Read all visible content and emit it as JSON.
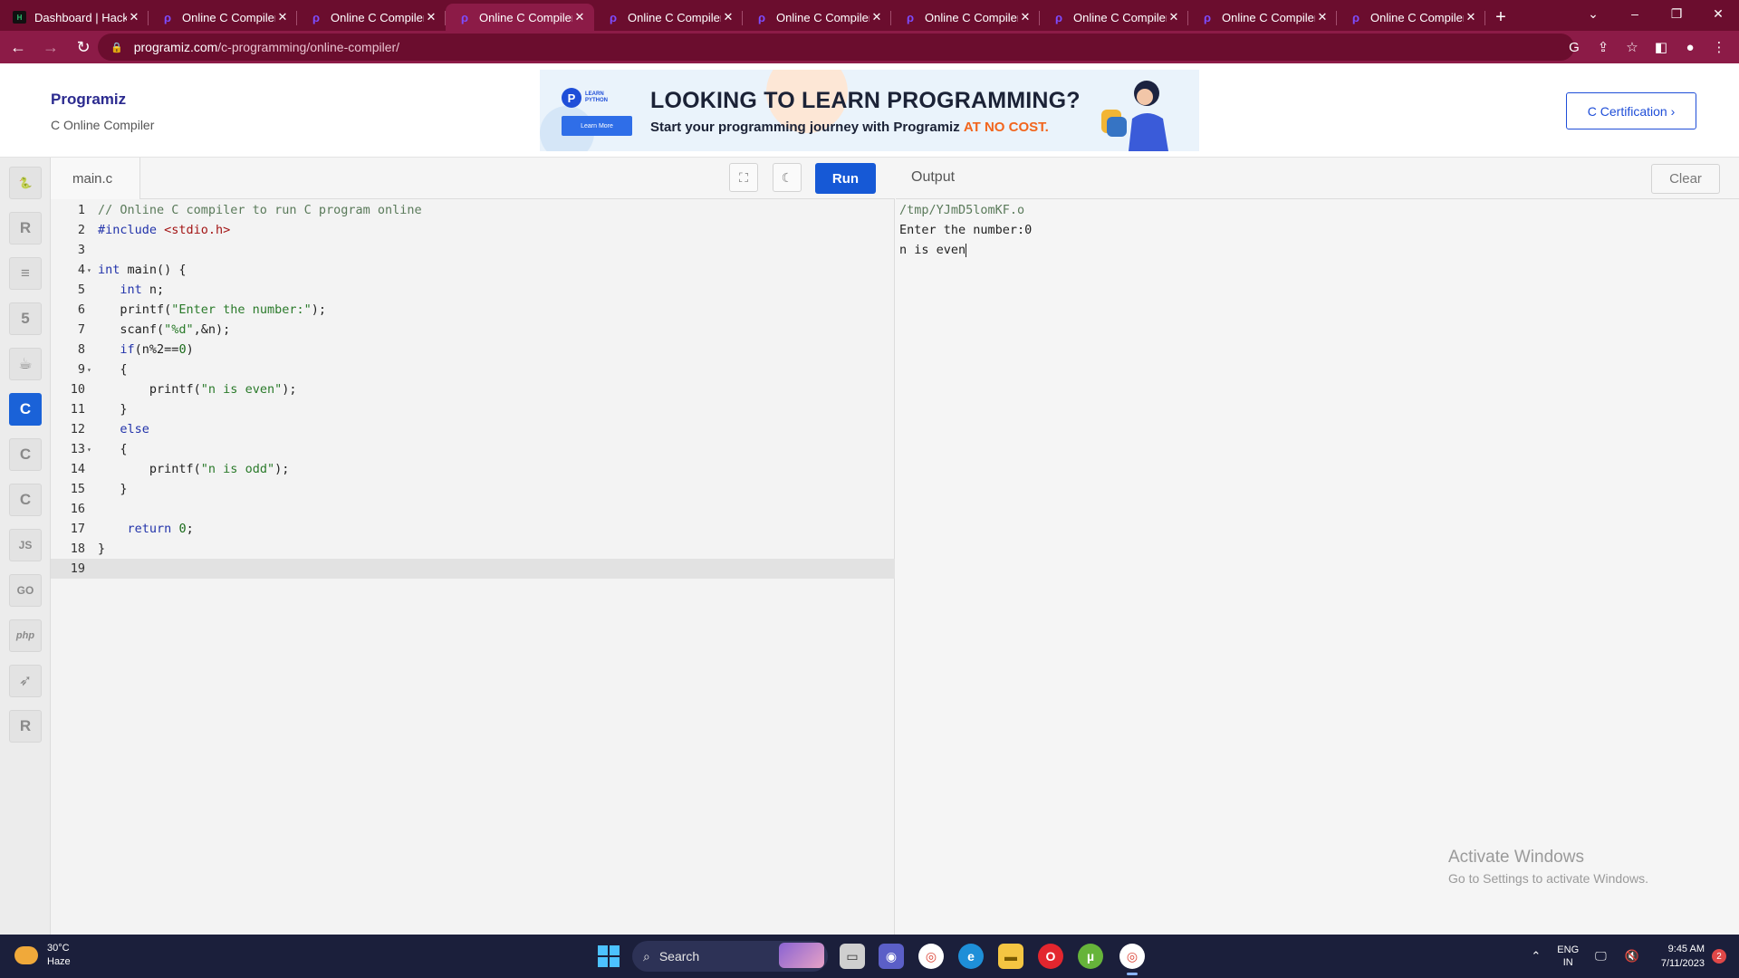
{
  "browser": {
    "tabs": [
      {
        "title": "Dashboard | Hackerr",
        "favicon": "hackerrank-icon",
        "active": false
      },
      {
        "title": "Online C Compiler",
        "favicon": "programiz-icon",
        "active": false
      },
      {
        "title": "Online C Compiler",
        "favicon": "programiz-icon",
        "active": false
      },
      {
        "title": "Online C Compiler",
        "favicon": "programiz-icon",
        "active": true
      },
      {
        "title": "Online C Compiler",
        "favicon": "programiz-icon",
        "active": false
      },
      {
        "title": "Online C Compiler",
        "favicon": "programiz-icon",
        "active": false
      },
      {
        "title": "Online C Compiler",
        "favicon": "programiz-icon",
        "active": false
      },
      {
        "title": "Online C Compiler",
        "favicon": "programiz-icon",
        "active": false
      },
      {
        "title": "Online C Compiler",
        "favicon": "programiz-icon",
        "active": false
      },
      {
        "title": "Online C Compiler",
        "favicon": "programiz-icon",
        "active": false
      }
    ],
    "url_host": "programiz.com",
    "url_path": "/c-programming/online-compiler/",
    "accent_color": "#8c1b47",
    "tabstrip_color": "#6b0d2e"
  },
  "site": {
    "logo": "Programiz",
    "subtitle": "C Online Compiler",
    "certification_button": "C Certification ›"
  },
  "ad": {
    "badge_line1": "LEARN",
    "badge_line2": "PYTHON",
    "learn_more": "Learn More",
    "headline": "LOOKING TO LEARN PROGRAMMING?",
    "subline": "Start your programming journey with Programiz ",
    "subline_highlight": "AT NO COST."
  },
  "languages": [
    {
      "name": "python-icon",
      "glyph": "🐍",
      "active": false
    },
    {
      "name": "r-icon",
      "glyph": "R",
      "active": false
    },
    {
      "name": "sql-icon",
      "glyph": "≡",
      "active": false
    },
    {
      "name": "html-icon",
      "glyph": "5",
      "active": false
    },
    {
      "name": "java-icon",
      "glyph": "☕",
      "active": false
    },
    {
      "name": "c-icon",
      "glyph": "C",
      "active": true
    },
    {
      "name": "cpp-icon",
      "glyph": "C",
      "active": false
    },
    {
      "name": "csharp-icon",
      "glyph": "C",
      "active": false
    },
    {
      "name": "javascript-icon",
      "glyph": "JS",
      "active": false
    },
    {
      "name": "go-icon",
      "glyph": "GO",
      "active": false
    },
    {
      "name": "php-icon",
      "glyph": "php",
      "active": false
    },
    {
      "name": "swift-icon",
      "glyph": "➶",
      "active": false
    },
    {
      "name": "rust-icon",
      "glyph": "R",
      "active": false
    }
  ],
  "editor": {
    "filename": "main.c",
    "run_label": "Run",
    "current_line": 19,
    "lines": [
      {
        "n": "1",
        "fold": false,
        "tokens": [
          {
            "t": "// Online C compiler to run C program online",
            "c": "t-c"
          }
        ]
      },
      {
        "n": "2",
        "fold": false,
        "tokens": [
          {
            "t": "#include ",
            "c": "t-k"
          },
          {
            "t": "<stdio.h>",
            "c": "t-s"
          }
        ]
      },
      {
        "n": "3",
        "fold": false,
        "tokens": []
      },
      {
        "n": "4",
        "fold": true,
        "tokens": [
          {
            "t": "int",
            "c": "t-k"
          },
          {
            "t": " main() {",
            "c": ""
          }
        ]
      },
      {
        "n": "5",
        "fold": false,
        "tokens": [
          {
            "t": "   ",
            "c": ""
          },
          {
            "t": "int",
            "c": "t-k"
          },
          {
            "t": " n;",
            "c": ""
          }
        ]
      },
      {
        "n": "6",
        "fold": false,
        "tokens": [
          {
            "t": "   printf(",
            "c": ""
          },
          {
            "t": "\"Enter the number:\"",
            "c": "t-sg"
          },
          {
            "t": ");",
            "c": ""
          }
        ]
      },
      {
        "n": "7",
        "fold": false,
        "tokens": [
          {
            "t": "   scanf(",
            "c": ""
          },
          {
            "t": "\"%d\"",
            "c": "t-sg"
          },
          {
            "t": ",&n);",
            "c": ""
          }
        ]
      },
      {
        "n": "8",
        "fold": false,
        "tokens": [
          {
            "t": "   ",
            "c": ""
          },
          {
            "t": "if",
            "c": "t-k"
          },
          {
            "t": "(n%2==",
            "c": ""
          },
          {
            "t": "0",
            "c": "t-n"
          },
          {
            "t": ")",
            "c": ""
          }
        ]
      },
      {
        "n": "9",
        "fold": true,
        "tokens": [
          {
            "t": "   {",
            "c": ""
          }
        ]
      },
      {
        "n": "10",
        "fold": false,
        "tokens": [
          {
            "t": "       printf(",
            "c": ""
          },
          {
            "t": "\"n is even\"",
            "c": "t-sg"
          },
          {
            "t": ");",
            "c": ""
          }
        ]
      },
      {
        "n": "11",
        "fold": false,
        "tokens": [
          {
            "t": "   }",
            "c": ""
          }
        ]
      },
      {
        "n": "12",
        "fold": false,
        "tokens": [
          {
            "t": "   ",
            "c": ""
          },
          {
            "t": "else",
            "c": "t-k"
          }
        ]
      },
      {
        "n": "13",
        "fold": true,
        "tokens": [
          {
            "t": "   {",
            "c": ""
          }
        ]
      },
      {
        "n": "14",
        "fold": false,
        "tokens": [
          {
            "t": "       printf(",
            "c": ""
          },
          {
            "t": "\"n is odd\"",
            "c": "t-sg"
          },
          {
            "t": ");",
            "c": ""
          }
        ]
      },
      {
        "n": "15",
        "fold": false,
        "tokens": [
          {
            "t": "   }",
            "c": ""
          }
        ]
      },
      {
        "n": "16",
        "fold": false,
        "tokens": []
      },
      {
        "n": "17",
        "fold": false,
        "tokens": [
          {
            "t": "    ",
            "c": ""
          },
          {
            "t": "return",
            "c": "t-k"
          },
          {
            "t": " ",
            "c": ""
          },
          {
            "t": "0",
            "c": "t-n"
          },
          {
            "t": ";",
            "c": ""
          }
        ]
      },
      {
        "n": "18",
        "fold": false,
        "tokens": [
          {
            "t": "}",
            "c": ""
          }
        ]
      },
      {
        "n": "19",
        "fold": false,
        "tokens": []
      }
    ]
  },
  "output": {
    "title": "Output",
    "clear_label": "Clear",
    "lines": [
      "/tmp/YJmD5lomKF.o",
      "Enter the number:0",
      "n is even"
    ]
  },
  "watermark": {
    "line1": "Activate Windows",
    "line2": "Go to Settings to activate Windows."
  },
  "taskbar": {
    "temperature": "30°C",
    "weather": "Haze",
    "search_placeholder": "Search",
    "lang_line1": "ENG",
    "lang_line2": "IN",
    "time": "9:45 AM",
    "date": "7/11/2023",
    "notification_count": "2"
  }
}
